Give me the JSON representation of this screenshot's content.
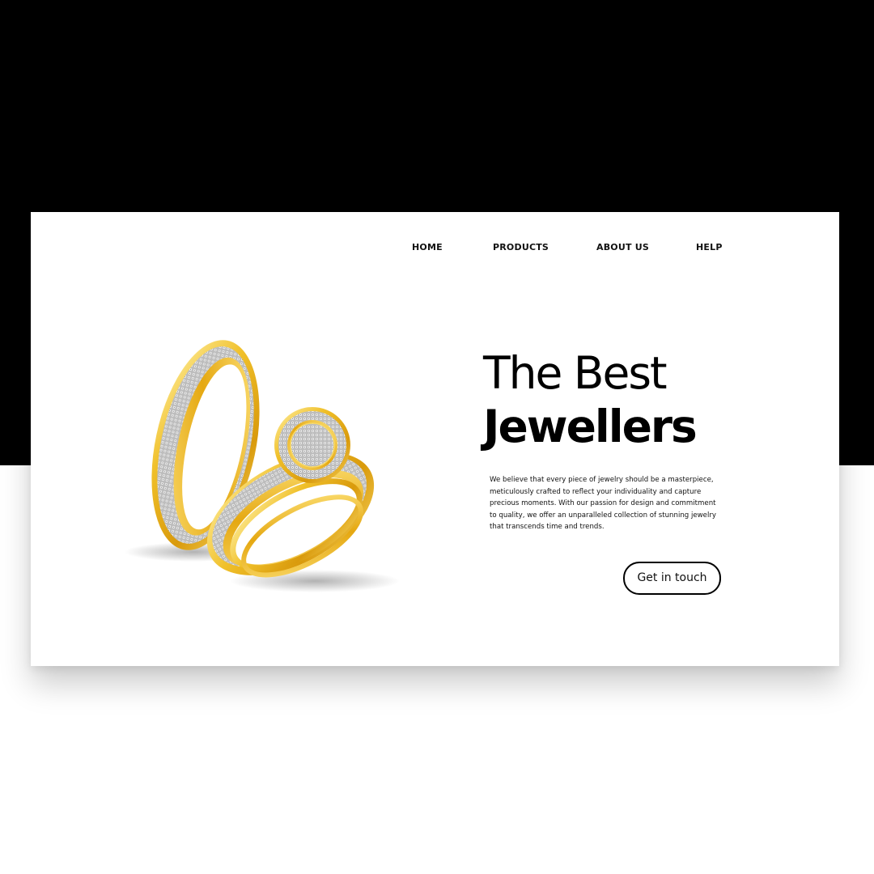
{
  "nav": {
    "items": [
      {
        "label": "HOME"
      },
      {
        "label": "PRODUCTS"
      },
      {
        "label": "ABOUT US"
      },
      {
        "label": "HELP"
      }
    ]
  },
  "hero": {
    "title_line1": "The Best",
    "title_line2": "Jewellers",
    "description": "We believe that every piece of jewelry should be a masterpiece, meticulously crafted to reflect your individuality and capture precious moments. With our passion for design and commitment to quality, we offer an unparalleled collection of stunning jewelry that transcends time and trends.",
    "cta_label": "Get in touch"
  },
  "colors": {
    "background_band": "#000000",
    "card": "#ffffff",
    "gold": "#e8b21c",
    "text": "#000000"
  }
}
